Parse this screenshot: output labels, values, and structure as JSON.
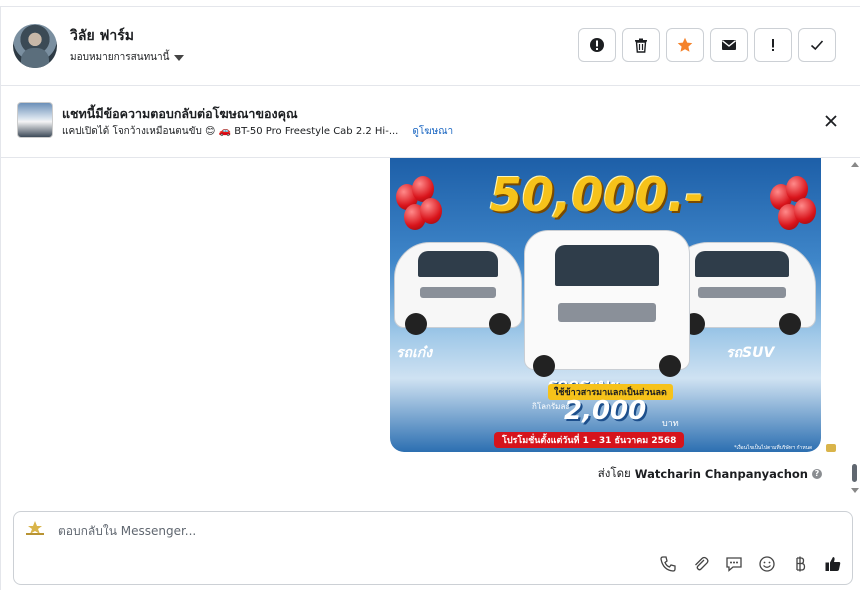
{
  "header": {
    "contact_name": "วิลัย ฟาร์ม",
    "assign_label": "มอบหมายการสนทนานี้",
    "actions": [
      {
        "name": "mark-spam-button",
        "icon": "alert-circle-icon"
      },
      {
        "name": "delete-button",
        "icon": "trash-icon"
      },
      {
        "name": "follow-up-button",
        "icon": "star-icon"
      },
      {
        "name": "mark-unread-button",
        "icon": "envelope-icon"
      },
      {
        "name": "priority-button",
        "icon": "exclamation-icon"
      },
      {
        "name": "mark-done-button",
        "icon": "checkmark-icon"
      }
    ]
  },
  "ad_banner": {
    "title": "แชทนี้มีข้อความตอบกลับต่อโฆษณาของคุณ",
    "subtitle": "แคปเปิดได้ โจกว้างเหมือนตนขับ 😊 🚗 BT-50 Pro Freestyle Cab 2.2 Hi-...",
    "link_label": "ดูโฆษณา"
  },
  "message": {
    "image": {
      "amount": "50,000.-",
      "label_old_car": "รถเก๋ง",
      "label_pickup": "รถกระบะ",
      "label_suv": "รถSUV",
      "trade_in_note": "ใช้ข้าวสารมาแลกเป็นส่วนลด",
      "price_prefix": "กิโลกรัมละ",
      "price": "2,000",
      "price_unit": "บาท",
      "promo_period": "โปรโมชั่นตั้งแต่วันที่ 1 - 31 ธันวาคม 2568",
      "fine_print": "*เงื่อนไขเป็นไปตามที่บริษัทฯ กำหนด"
    },
    "sent_by_label": "ส่งโดย",
    "sender_name": "Watcharin Chanpanyachon"
  },
  "composer": {
    "placeholder": "ตอบกลับใน Messenger...",
    "tools": [
      "phone-icon",
      "paperclip-icon",
      "chat-bubble-icon",
      "smiley-icon",
      "baht-icon",
      "thumbs-up-icon"
    ]
  },
  "colors": {
    "accent_link": "#1a66c2",
    "star": "#f5822a",
    "border": "#ccd0d5",
    "promo_yellow": "#f6c21a",
    "promo_red": "#d6141c"
  }
}
